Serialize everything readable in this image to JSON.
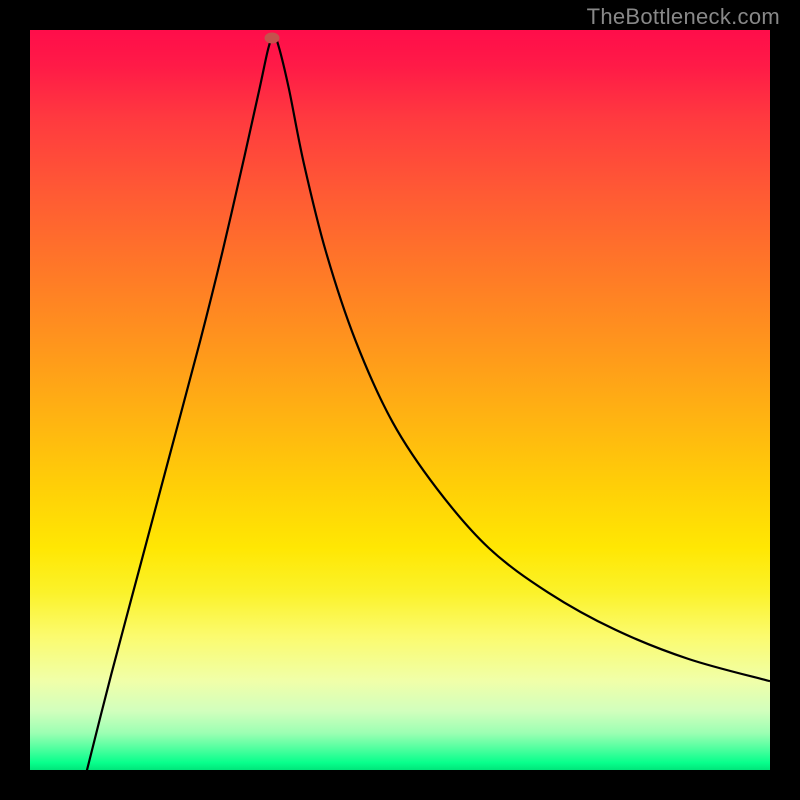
{
  "watermark": "TheBottleneck.com",
  "chart_data": {
    "type": "line",
    "title": "",
    "xlabel": "",
    "ylabel": "",
    "xlim": [
      0,
      100
    ],
    "ylim": [
      0,
      100
    ],
    "grid": false,
    "marker": {
      "x_pct": 32.7,
      "y_pct": 98.9
    },
    "series": [
      {
        "name": "curve",
        "points_pct": [
          [
            7.2,
            -2.0
          ],
          [
            11.0,
            13.0
          ],
          [
            15.0,
            28.0
          ],
          [
            19.0,
            43.0
          ],
          [
            23.0,
            58.0
          ],
          [
            26.0,
            70.0
          ],
          [
            29.0,
            83.0
          ],
          [
            31.0,
            92.0
          ],
          [
            32.2,
            97.5
          ],
          [
            32.9,
            99.2
          ],
          [
            33.6,
            97.8
          ],
          [
            35.0,
            92.0
          ],
          [
            37.0,
            82.0
          ],
          [
            40.0,
            70.0
          ],
          [
            44.0,
            58.0
          ],
          [
            49.0,
            47.0
          ],
          [
            55.0,
            38.0
          ],
          [
            62.0,
            30.0
          ],
          [
            70.0,
            24.0
          ],
          [
            79.0,
            19.0
          ],
          [
            89.0,
            15.0
          ],
          [
            100.0,
            12.0
          ]
        ]
      }
    ],
    "background_gradient_stops": [
      {
        "pct": 0,
        "color": "#ff0d4a"
      },
      {
        "pct": 12,
        "color": "#ff3a3f"
      },
      {
        "pct": 32,
        "color": "#ff7728"
      },
      {
        "pct": 52,
        "color": "#ffb212"
      },
      {
        "pct": 70,
        "color": "#ffe703"
      },
      {
        "pct": 82,
        "color": "#fbfb6f"
      },
      {
        "pct": 92,
        "color": "#d2ffbd"
      },
      {
        "pct": 99,
        "color": "#08ff8c"
      },
      {
        "pct": 100,
        "color": "#00e57a"
      }
    ]
  }
}
